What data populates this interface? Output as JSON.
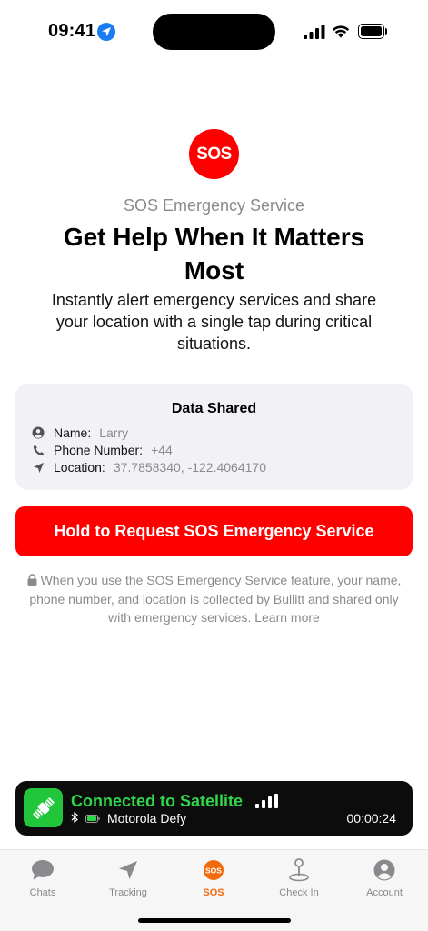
{
  "status_bar": {
    "time": "09:41"
  },
  "hero": {
    "logo_text": "SOS",
    "eyebrow": "SOS Emergency Service",
    "headline": "Get Help When It Matters Most",
    "subtext": "Instantly alert emergency services and share your location with a single tap during critical situations."
  },
  "data_card": {
    "title": "Data Shared",
    "rows": [
      {
        "icon": "person-circle-icon",
        "label": "Name:",
        "value": "Larry"
      },
      {
        "icon": "phone-icon",
        "label": "Phone Number:",
        "value": "+44"
      },
      {
        "icon": "location-arrow-icon",
        "label": "Location:",
        "value": "37.7858340, -122.4064170"
      }
    ]
  },
  "sos_button": {
    "label": "Hold to Request SOS Emergency Service"
  },
  "disclaimer": {
    "text": "When you use the SOS Emergency Service feature, your name, phone number, and location is collected by Bullitt and shared only with emergency services. Learn more"
  },
  "satellite": {
    "title": "Connected to Satellite",
    "device": "Motorola Defy",
    "timer": "00:00:24",
    "accent": "#2fd64a"
  },
  "tabs": [
    {
      "label": "Chats",
      "icon": "chat-bubble-icon",
      "active": false
    },
    {
      "label": "Tracking",
      "icon": "navigation-arrow-icon",
      "active": false
    },
    {
      "label": "SOS",
      "icon": "sos-icon",
      "active": true
    },
    {
      "label": "Check In",
      "icon": "map-pin-icon",
      "active": false
    },
    {
      "label": "Account",
      "icon": "account-icon",
      "active": false
    }
  ],
  "colors": {
    "sos_red": "#ff0000",
    "active_tab": "#f26a0c",
    "muted": "#8a8a8e"
  }
}
